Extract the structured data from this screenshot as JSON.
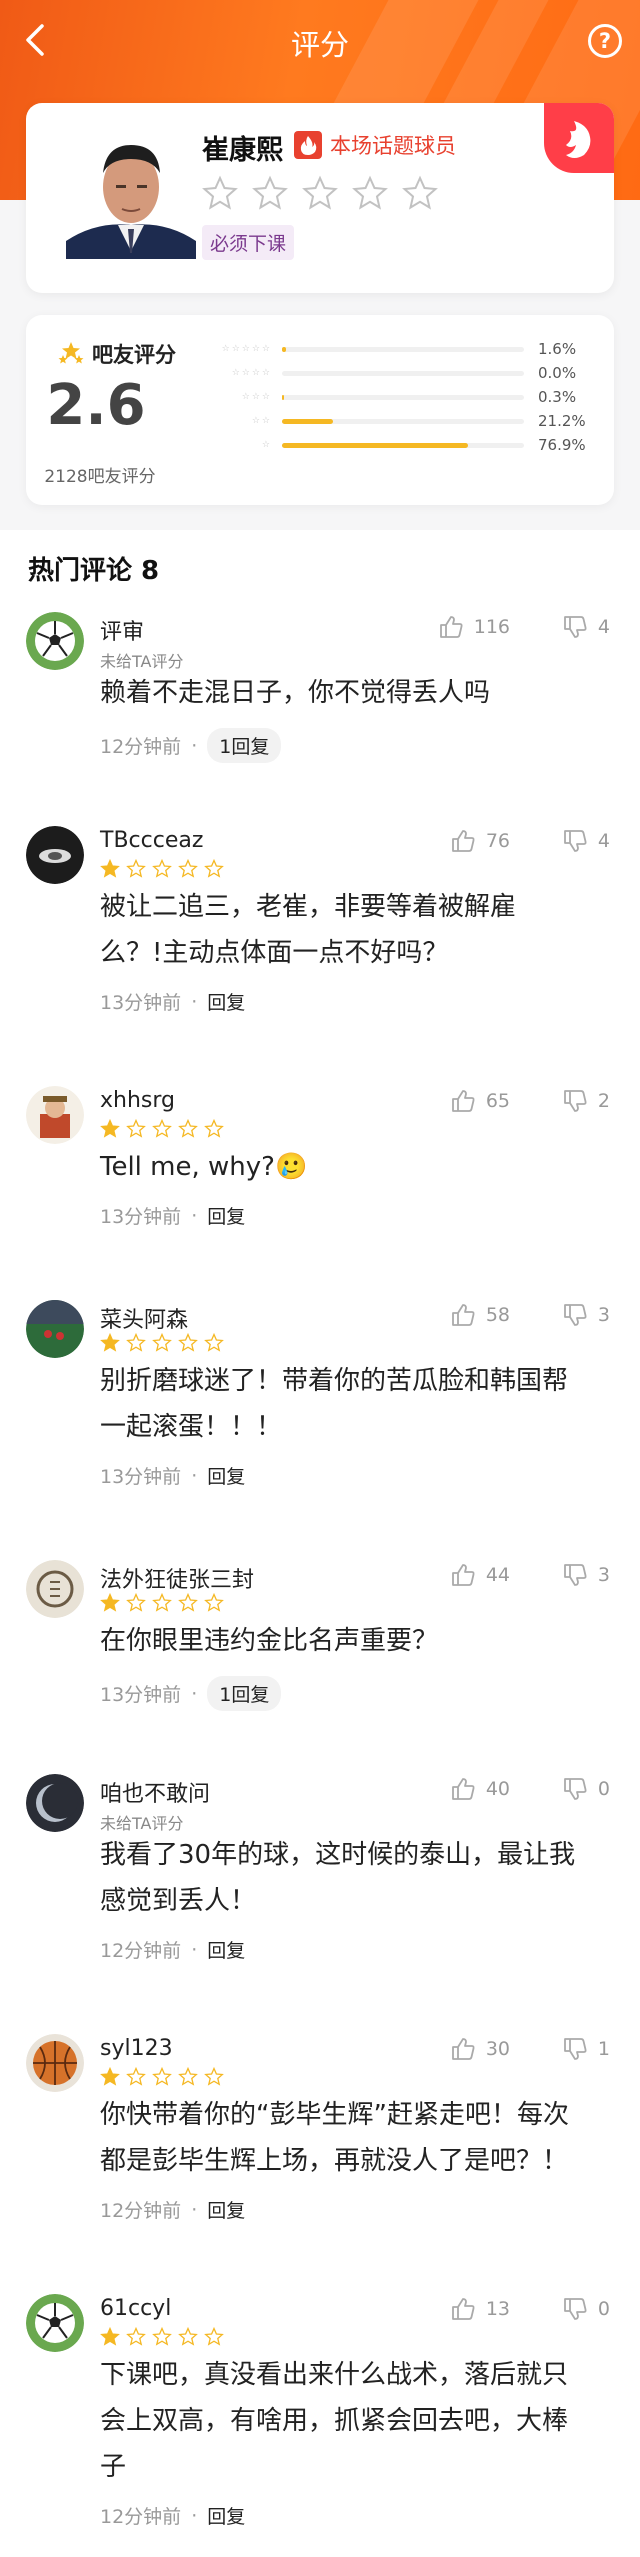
{
  "nav": {
    "title": "评分"
  },
  "player": {
    "name": "崔康熙",
    "badge": "本场话题球员",
    "tag": "必须下课"
  },
  "rating": {
    "label": "吧友评分",
    "score": "2.6",
    "count": "2128吧友评分",
    "distribution": [
      {
        "stars": 5,
        "pct": "1.6%",
        "value": 1.6
      },
      {
        "stars": 4,
        "pct": "0.0%",
        "value": 0.0
      },
      {
        "stars": 3,
        "pct": "0.3%",
        "value": 0.3
      },
      {
        "stars": 2,
        "pct": "21.2%",
        "value": 21.2
      },
      {
        "stars": 1,
        "pct": "76.9%",
        "value": 76.9
      }
    ]
  },
  "section": {
    "title": "热门评论 8"
  },
  "comments": [
    {
      "user": "评审",
      "sub": "未给TA评分",
      "stars": 0,
      "likes": "116",
      "dislikes": "4",
      "text": [
        "赖着不走混日子，你不觉得丢人吗"
      ],
      "time": "12分钟前",
      "reply": "1回复",
      "avatar": "soccer"
    },
    {
      "user": "TBccceaz",
      "sub": "",
      "stars": 1,
      "likes": "76",
      "dislikes": "4",
      "text": [
        "被让二追三，老崔，非要等着被解雇",
        "么？!主动点体面一点不好吗？"
      ],
      "time": "13分钟前",
      "reply": "回复",
      "avatar": "dark"
    },
    {
      "user": "xhhsrg",
      "sub": "",
      "stars": 1,
      "likes": "65",
      "dislikes": "2",
      "text": [
        "Tell me, why?🥲"
      ],
      "time": "13分钟前",
      "reply": "回复",
      "avatar": "person"
    },
    {
      "user": "菜头阿森",
      "sub": "",
      "stars": 1,
      "likes": "58",
      "dislikes": "3",
      "text": [
        "别折磨球迷了！带着你的苦瓜脸和韩国帮",
        "一起滚蛋！！！"
      ],
      "time": "13分钟前",
      "reply": "回复",
      "avatar": "stadium"
    },
    {
      "user": "法外狂徒张三封",
      "sub": "",
      "stars": 1,
      "likes": "44",
      "dislikes": "3",
      "text": [
        "在你眼里违约金比名声重要？"
      ],
      "time": "13分钟前",
      "reply": "1回复",
      "avatar": "circle"
    },
    {
      "user": "咱也不敢问",
      "sub": "未给TA评分",
      "stars": 0,
      "likes": "40",
      "dislikes": "0",
      "text": [
        "我看了30年的球，这时候的泰山，最让我",
        "感觉到丢人！"
      ],
      "time": "12分钟前",
      "reply": "回复",
      "avatar": "moon"
    },
    {
      "user": "syl123",
      "sub": "",
      "stars": 1,
      "likes": "30",
      "dislikes": "1",
      "text": [
        "你快带着你的“彭毕生辉”赶紧走吧！每次",
        "都是彭毕生辉上场，再就没人了是吧？！"
      ],
      "time": "12分钟前",
      "reply": "回复",
      "avatar": "basketball"
    },
    {
      "user": "61ccyl",
      "sub": "",
      "stars": 1,
      "likes": "13",
      "dislikes": "0",
      "text": [
        "下课吧，真没看出来什么战术，落后就只",
        "会上双高，有啥用，抓紧会回去吧，大棒",
        "子"
      ],
      "time": "12分钟前",
      "reply": "回复",
      "avatar": "soccer"
    }
  ],
  "colors": {
    "accent": "#ff6a13",
    "star": "#f5b823",
    "badge": "#e8412f"
  }
}
